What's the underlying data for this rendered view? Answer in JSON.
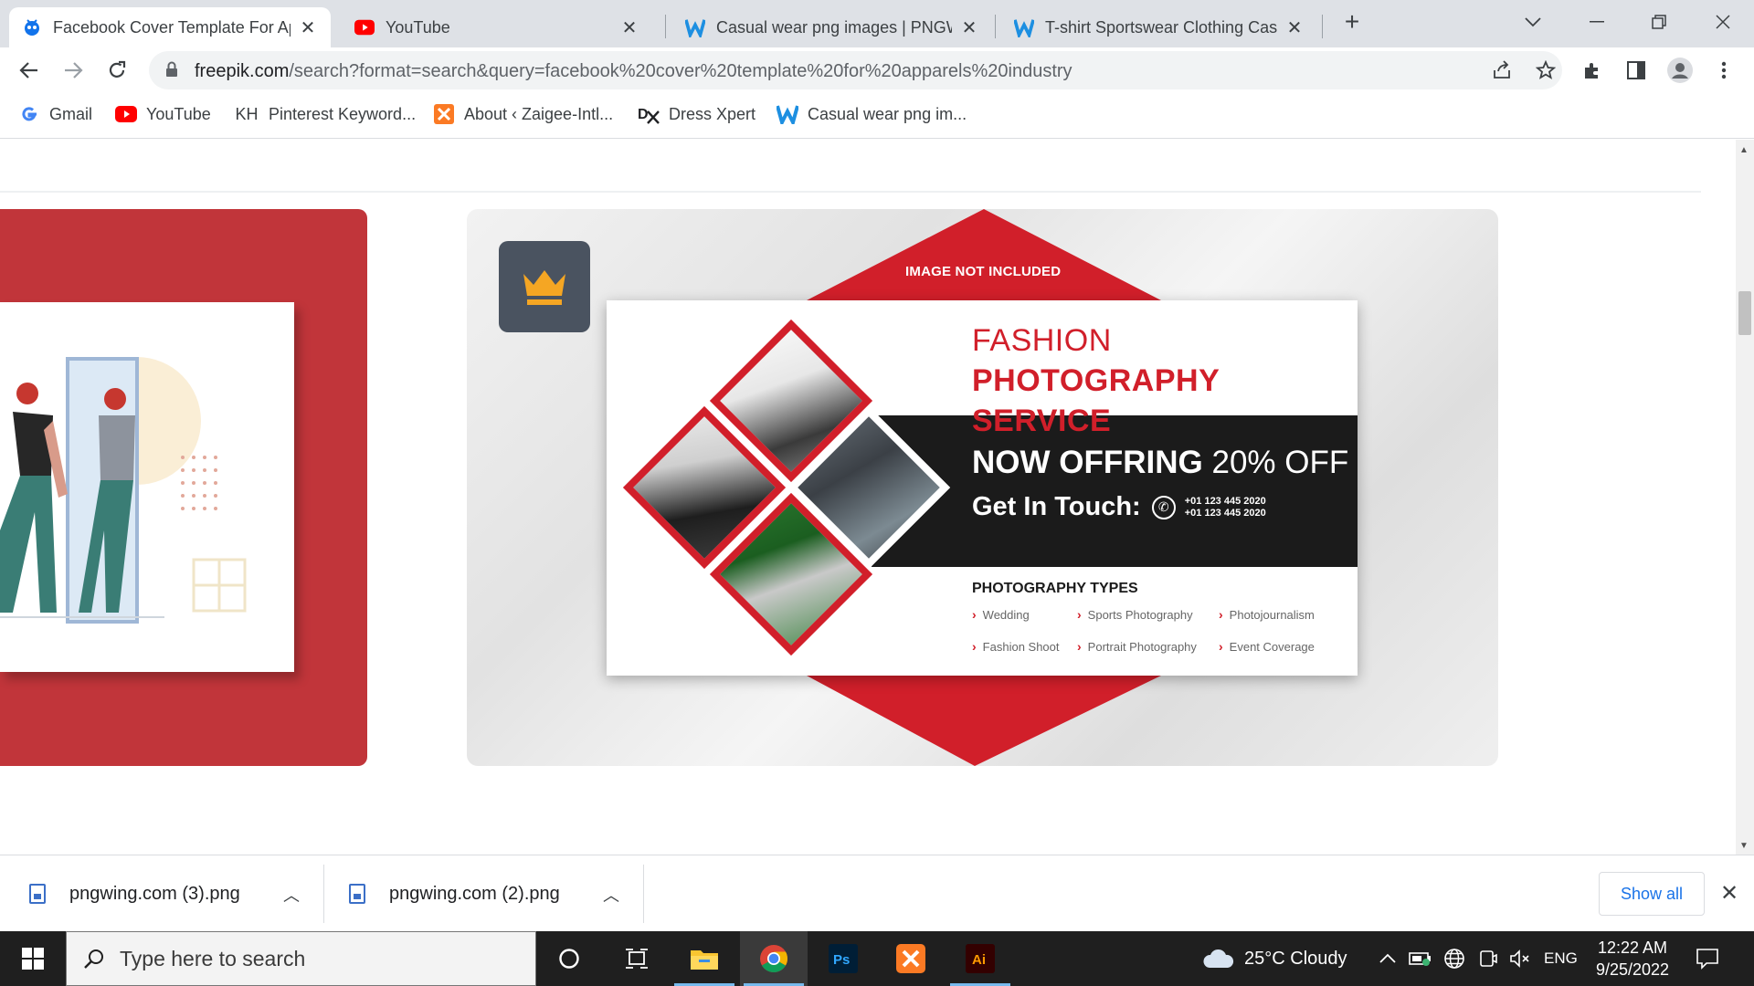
{
  "colors": {
    "tab_strip": "#dee1e6",
    "brand_red": "#d11f2a",
    "card_red": "#c1353a",
    "crown_gold": "#f5a623",
    "link_blue": "#1a73e8",
    "taskbar": "#1f1f1f"
  },
  "tabs": [
    {
      "title": "Facebook Cover Template For Ap",
      "icon": "freepik-icon",
      "active": true
    },
    {
      "title": "YouTube",
      "icon": "youtube-icon",
      "active": false
    },
    {
      "title": "Casual wear png images | PNGW",
      "icon": "pngwing-icon",
      "active": false
    },
    {
      "title": "T-shirt Sportswear Clothing Casu",
      "icon": "pngwing-icon",
      "active": false
    }
  ],
  "address_bar": {
    "host": "freepik.com",
    "path": "/search?format=search&query=facebook%20cover%20template%20for%20apparels%20industry"
  },
  "bookmarks": [
    {
      "label": "Gmail",
      "icon": "google-icon"
    },
    {
      "label": "YouTube",
      "icon": "youtube-icon"
    },
    {
      "label": "Pinterest Keyword...",
      "icon": "KH"
    },
    {
      "label": "About ‹ Zaigee-Intl...",
      "icon": "xampp-icon"
    },
    {
      "label": "Dress Xpert",
      "icon": "dx-icon"
    },
    {
      "label": "Casual wear png im...",
      "icon": "pngwing-icon"
    }
  ],
  "banner": {
    "image_note": "IMAGE NOT INCLUDED",
    "title_word1": "FASHION",
    "title_word2": "PHOTOGRAPHY",
    "title_line2": "SERVICE",
    "offer_bold": "NOW OFFRING",
    "offer_value": "20% OFF",
    "touch_label": "Get In Touch:",
    "phone_1": "+01 123 445 2020",
    "phone_2": "+01 123 445 2020",
    "types_title": "PHOTOGRAPHY TYPES",
    "types": [
      "Wedding",
      "Sports Photography",
      "Photojournalism",
      "Fashion Shoot",
      "Portrait Photography",
      "Event Coverage"
    ]
  },
  "downloads": [
    {
      "filename": "pngwing.com (3).png"
    },
    {
      "filename": "pngwing.com (2).png"
    }
  ],
  "downloads_show_all": "Show all",
  "taskbar": {
    "search_placeholder": "Type here to search",
    "weather": "25°C  Cloudy",
    "language": "ENG",
    "time": "12:22 AM",
    "date": "9/25/2022"
  }
}
